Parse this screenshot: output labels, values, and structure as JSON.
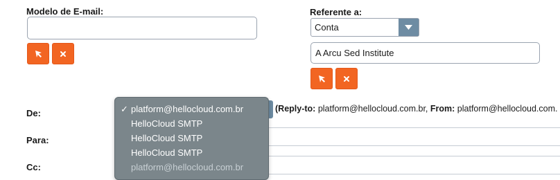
{
  "template_section": {
    "label": "Modelo de E-mail:",
    "input_value": ""
  },
  "reference_section": {
    "label": "Referente a:",
    "type_selected": "Conta",
    "related_value": "A Arcu Sed Institute"
  },
  "from_row": {
    "label": "De:",
    "reply_to_label": "(Reply-to:",
    "reply_to_value": "platform@hellocloud.com.br,",
    "from_label": "From:",
    "from_value": "platform@hellocloud.com."
  },
  "to_row": {
    "label": "Para:"
  },
  "cc_row": {
    "label": "Cc:"
  },
  "dropdown": {
    "check_glyph": "✓",
    "options": [
      "platform@hellocloud.com.br",
      "HelloCloud SMTP",
      "HelloCloud SMTP",
      "HelloCloud SMTP",
      "platform@hellocloud.com.br"
    ]
  },
  "colors": {
    "accent_button": "#f26522",
    "select_arrow": "#6e8ca3",
    "dropdown_bg": "#7b868b"
  },
  "icons": {
    "select": "cursor-arrow-icon",
    "clear": "close-x-icon",
    "dropdown": "caret-down-icon"
  }
}
